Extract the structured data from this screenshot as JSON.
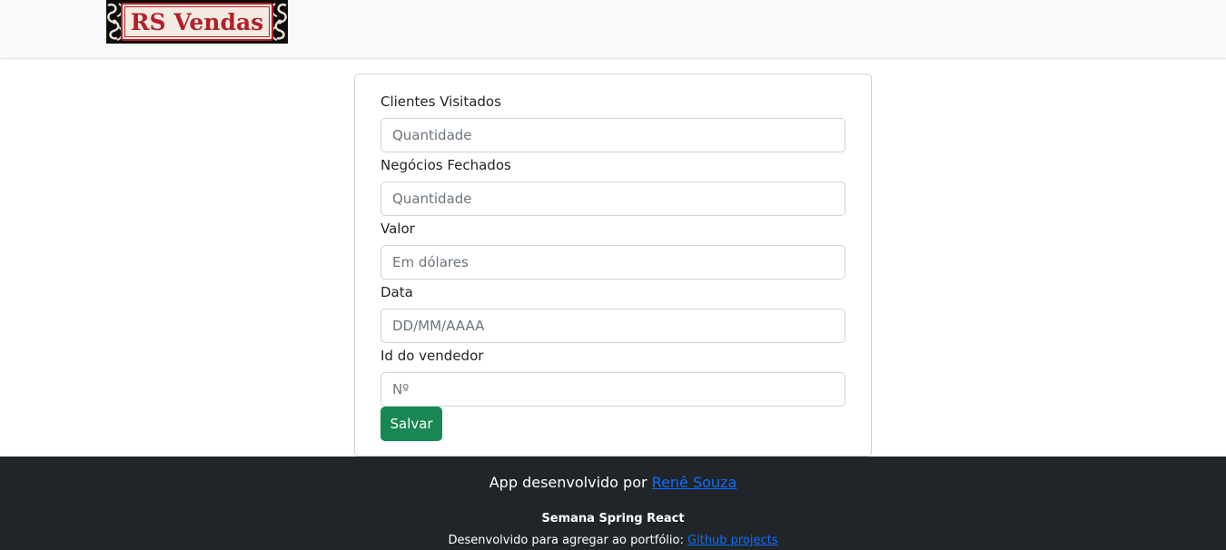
{
  "brand": {
    "logo_text": "RS Vendas"
  },
  "form": {
    "fields": [
      {
        "label": "Clientes Visitados",
        "placeholder": "Quantidade"
      },
      {
        "label": "Negócios Fechados",
        "placeholder": "Quantidade"
      },
      {
        "label": "Valor",
        "placeholder": "Em dólares"
      },
      {
        "label": "Data",
        "placeholder": "DD/MM/AAAA"
      },
      {
        "label": "Id do vendedor",
        "placeholder": "Nº"
      }
    ],
    "submit_label": "Salvar"
  },
  "footer": {
    "credit_prefix": "App desenvolvido por ",
    "credit_link": "Renê Souza",
    "title": "Semana Spring React",
    "portfolio_prefix": "Desenvolvido para agregar ao portfólio: ",
    "portfolio_link": "Github projects"
  },
  "colors": {
    "navbar_bg": "#f8f9fa",
    "brand_red": "#b3202a",
    "save_button": "#198754",
    "footer_bg": "#212529",
    "link": "#0d6efd"
  }
}
